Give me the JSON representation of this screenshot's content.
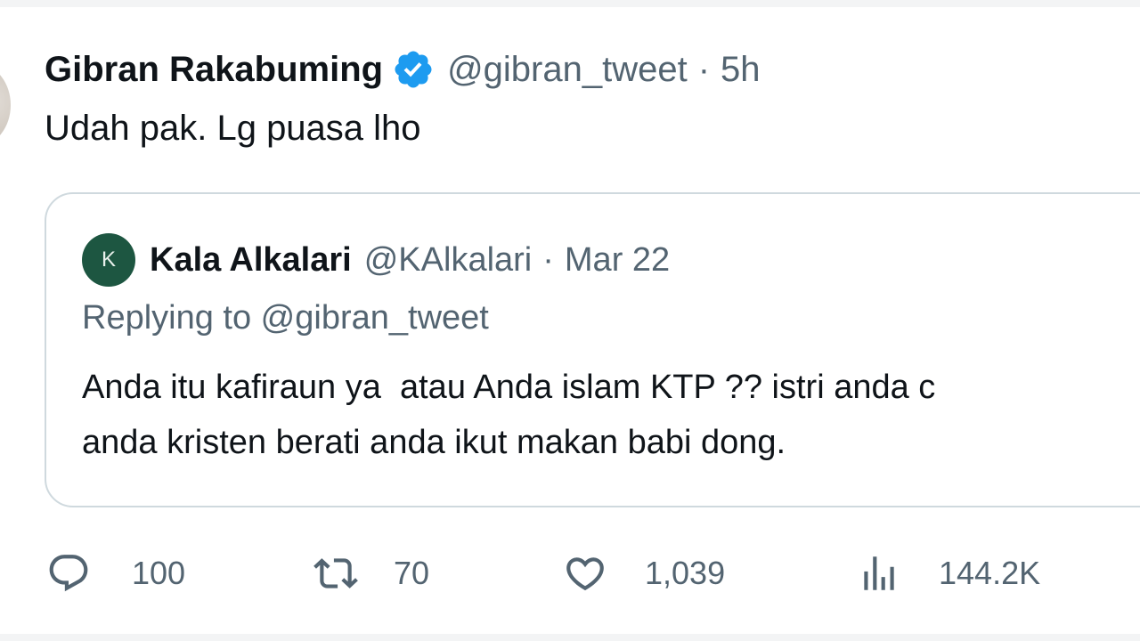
{
  "tweet": {
    "author_name": "Gibran Rakabuming",
    "author_handle": "@gibran_tweet",
    "separator": "·",
    "timestamp": "5h",
    "text": "Udah pak. Lg puasa lho"
  },
  "quoted": {
    "avatar_letter": "K",
    "author_name": "Kala Alkalari",
    "author_handle": "@KAlkalari",
    "separator": "·",
    "date": "Mar 22",
    "replying_to": "Replying to @gibran_tweet",
    "text_line1": "Anda itu kafiraun ya  atau Anda islam KTP ?? istri anda c",
    "text_line2": "anda kristen berati anda ikut makan babi dong."
  },
  "actions": {
    "reply_count": "100",
    "retweet_count": "70",
    "like_count": "1,039",
    "view_count": "144.2K"
  },
  "colors": {
    "verified": "#1d9bf0",
    "secondary_text": "#536471",
    "card_border": "#cfd9de",
    "quote_avatar_bg": "#1d5641"
  },
  "icons": [
    "verified-badge-icon",
    "reply-icon",
    "retweet-icon",
    "like-icon",
    "views-icon"
  ]
}
